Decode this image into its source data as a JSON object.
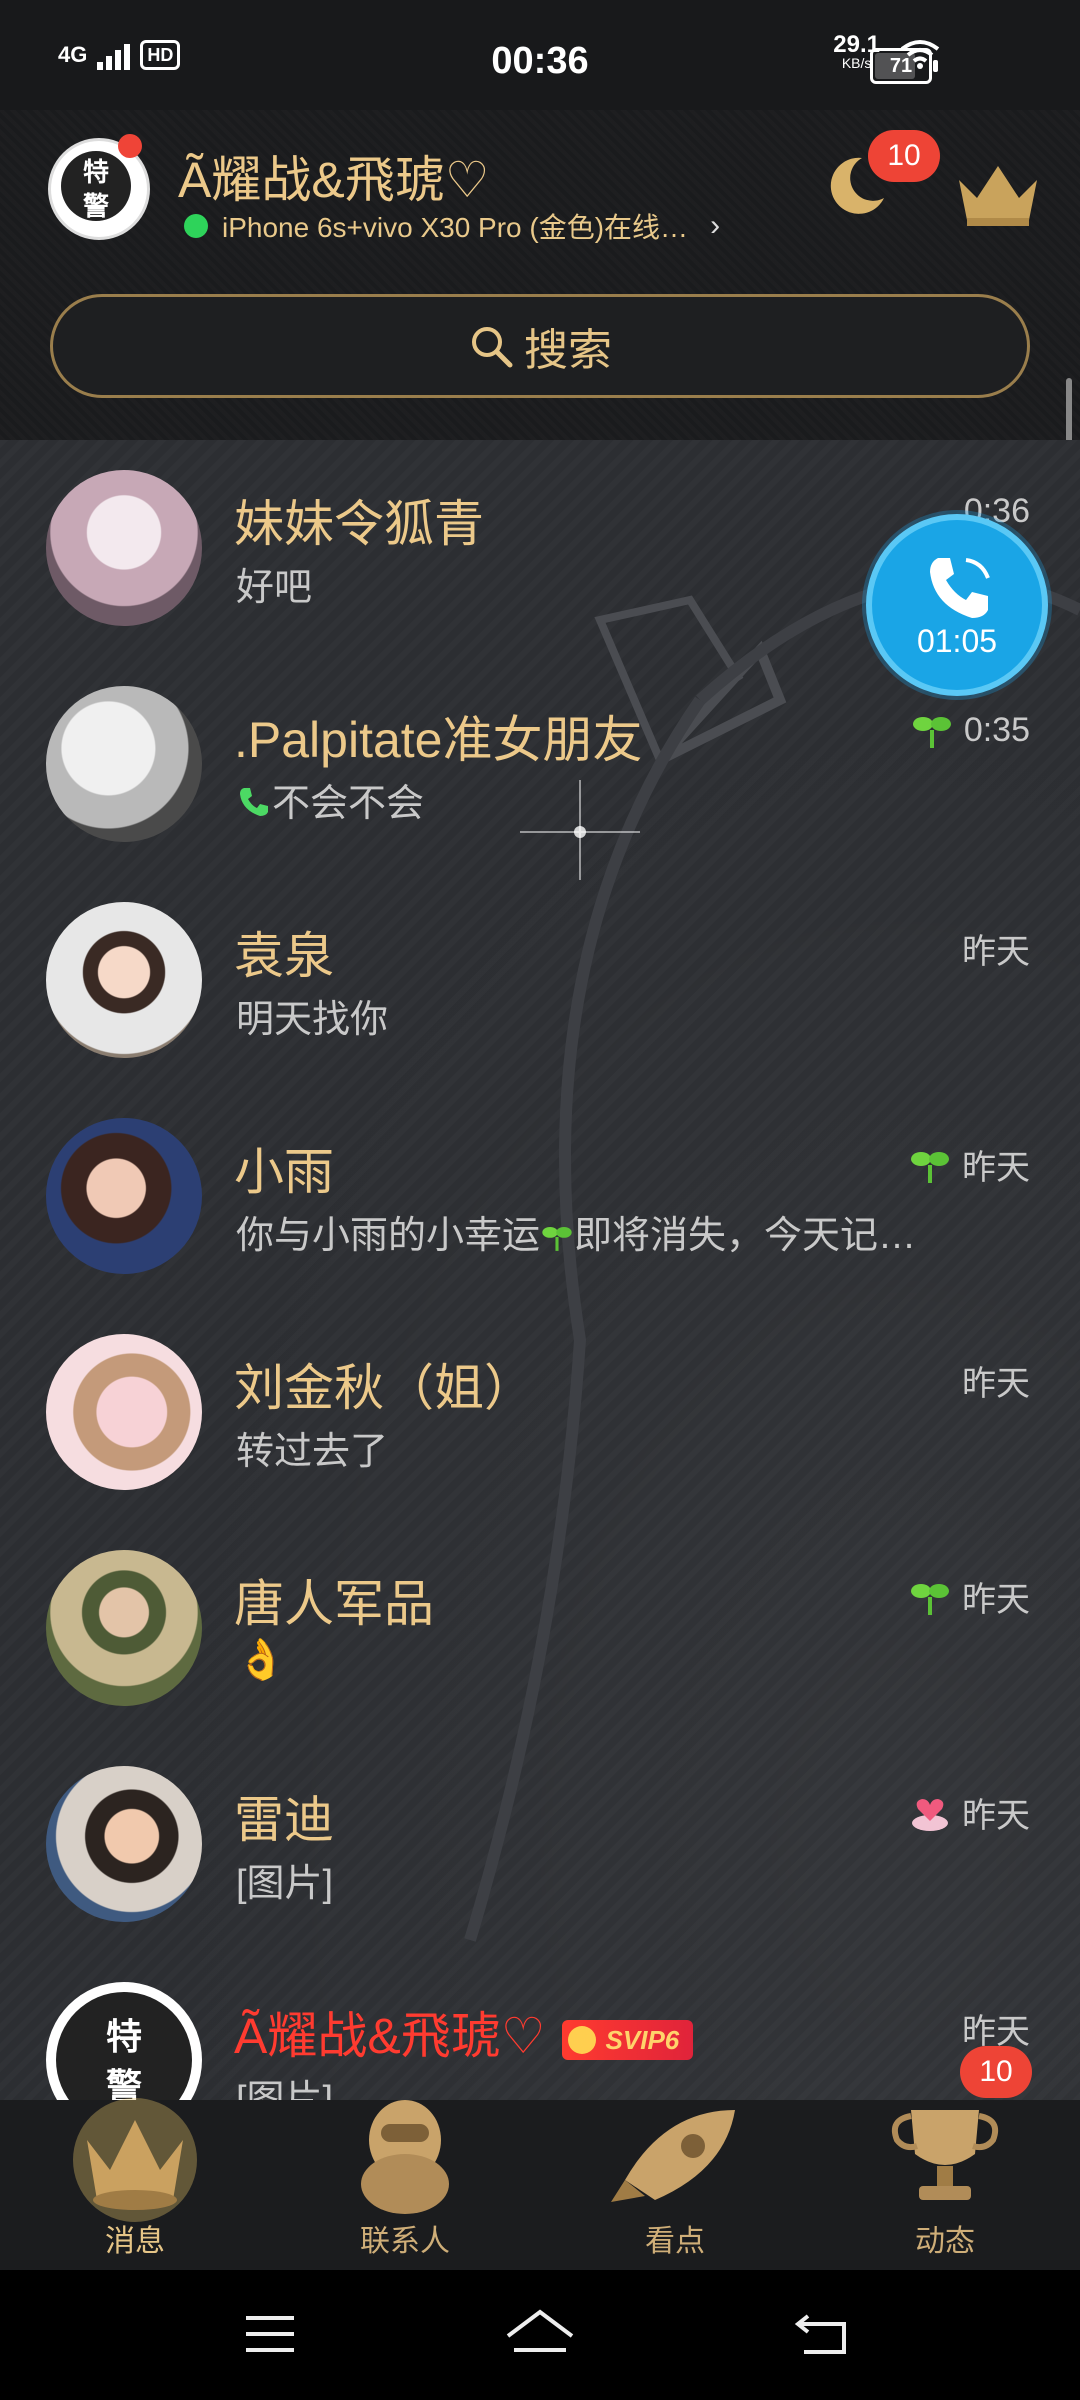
{
  "status_bar": {
    "network": "4G",
    "hd": "HD",
    "time": "00:36",
    "speed_value": "29.1",
    "speed_unit": "KB/s",
    "battery": "71"
  },
  "header": {
    "nickname": "Ã耀战&飛琥♡",
    "online_status": "iPhone 6s+vivo X30 Pro (金色)在线…",
    "moon_badge": "10",
    "search_placeholder": "搜索"
  },
  "call": {
    "duration": "01:05"
  },
  "conversations": [
    {
      "name": "妹妹令狐青",
      "message": "好吧",
      "time": "0:36",
      "icon": "none"
    },
    {
      "name": ".Palpitate准女朋友",
      "message": "不会不会",
      "time": "0:35",
      "icon": "sprout-icon",
      "message_icon": "phone-icon"
    },
    {
      "name": "袁泉",
      "message": "明天找你",
      "time": "昨天",
      "icon": "none"
    },
    {
      "name": "小雨",
      "message": "你与小雨的小幸运",
      "message_suffix": "即将消失，今天记…",
      "time": "昨天",
      "icon": "sprout-icon"
    },
    {
      "name": "刘金秋（姐）",
      "message": "转过去了",
      "time": "昨天",
      "icon": "none"
    },
    {
      "name": "唐人军品",
      "message": "👌",
      "time": "昨天",
      "icon": "sprout-icon"
    },
    {
      "name": "雷迪",
      "message": "[图片]",
      "time": "昨天",
      "icon": "heart-icon"
    },
    {
      "name": "Ã耀战&飛琥♡",
      "message": "[图片]",
      "time": "昨天",
      "icon": "none",
      "badge": "SVIP6"
    }
  ],
  "tabs": [
    {
      "label": "消息",
      "icon": "crown-icon",
      "active": true
    },
    {
      "label": "联系人",
      "icon": "penguin-icon",
      "active": false
    },
    {
      "label": "看点",
      "icon": "rocket-icon",
      "active": false
    },
    {
      "label": "动态",
      "icon": "trophy-icon",
      "active": false,
      "badge": "10"
    }
  ],
  "colors": {
    "accent_gold": "#ecc98a",
    "badge_red": "#ee4436",
    "call_blue": "#1aa5e6",
    "online_green": "#2ed35a"
  }
}
